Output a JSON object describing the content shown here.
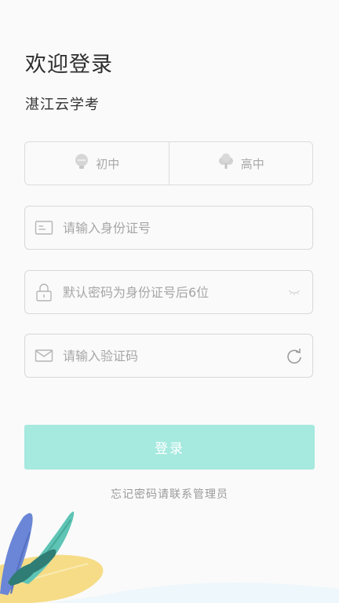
{
  "header": {
    "title": "欢迎登录",
    "subtitle": "湛江云学考"
  },
  "school_level": {
    "options": [
      {
        "label": "初中",
        "icon": "bulb-icon",
        "selected": false
      },
      {
        "label": "高中",
        "icon": "tree-icon",
        "selected": false
      }
    ]
  },
  "form": {
    "id_field": {
      "placeholder": "请输入身份证号",
      "icon": "id-card-icon"
    },
    "password_field": {
      "placeholder": "默认密码为身份证号后6位",
      "icon": "lock-icon",
      "toggle_icon": "eye-closed-icon"
    },
    "captcha_field": {
      "placeholder": "请输入验证码",
      "icon": "mail-icon",
      "refresh_icon": "refresh-icon"
    },
    "login_label": "登录",
    "forgot_text": "忘记密码请联系管理员"
  },
  "colors": {
    "accent": "#a6e9df",
    "background": "#fafafa",
    "border": "#d8d8d8"
  }
}
